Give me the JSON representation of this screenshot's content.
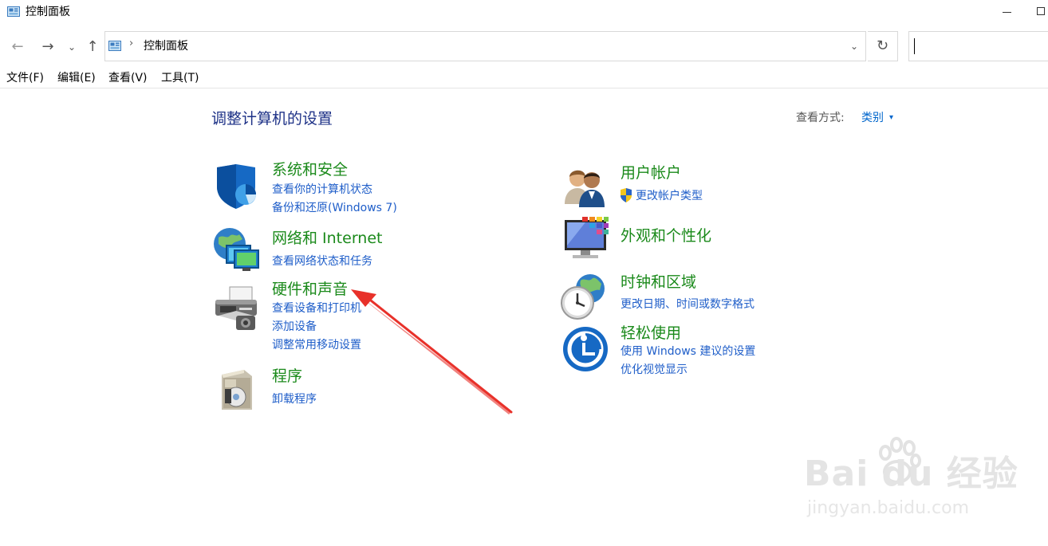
{
  "window": {
    "title": "控制面板",
    "icon": "control-panel-icon"
  },
  "nav": {
    "back": "←",
    "forward": "→",
    "recent": "⌄",
    "up": "↑",
    "refresh": "↻",
    "dropdown": "⌄",
    "separator": "›",
    "breadcrumb": "控制面板"
  },
  "menu": {
    "file": "文件(F)",
    "edit": "编辑(E)",
    "view": "查看(V)",
    "tools": "工具(T)"
  },
  "main": {
    "heading": "调整计算机的设置",
    "view_by_label": "查看方式:",
    "view_by_value": "类别",
    "view_by_arrow": "▾"
  },
  "categories": {
    "system_security": {
      "title": "系统和安全",
      "links": [
        "查看你的计算机状态",
        "备份和还原(Windows 7)"
      ],
      "icon": "shield-icon"
    },
    "network": {
      "title": "网络和 Internet",
      "links": [
        "查看网络状态和任务"
      ],
      "icon": "network-globe-icon"
    },
    "hardware_sound": {
      "title": "硬件和声音",
      "links": [
        "查看设备和打印机",
        "添加设备",
        "调整常用移动设置"
      ],
      "icon": "printer-icon"
    },
    "programs": {
      "title": "程序",
      "links": [
        "卸载程序"
      ],
      "icon": "programs-disc-icon"
    },
    "user_accounts": {
      "title": "用户帐户",
      "links": [
        "更改帐户类型"
      ],
      "icon": "users-icon",
      "link_icon": "uac-shield-icon"
    },
    "appearance": {
      "title": "外观和个性化",
      "links": [],
      "icon": "monitor-colors-icon"
    },
    "clock_region": {
      "title": "时钟和区域",
      "links": [
        "更改日期、时间或数字格式"
      ],
      "icon": "clock-globe-icon"
    },
    "ease_access": {
      "title": "轻松使用",
      "links": [
        "使用 Windows 建议的设置",
        "优化视觉显示"
      ],
      "icon": "ease-of-access-icon"
    }
  },
  "watermark": {
    "brand": "Bai du 经验",
    "url": "jingyan.baidu.com"
  },
  "annotation": {
    "arrow_color": "#e8312a",
    "target": "硬件和声音"
  }
}
